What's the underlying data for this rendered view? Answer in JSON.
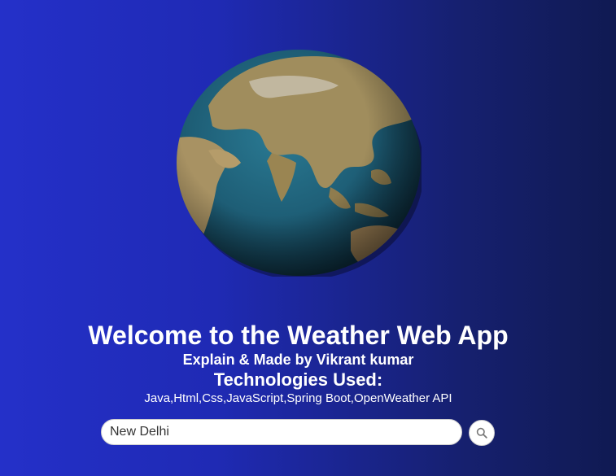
{
  "header": {
    "title": "Welcome to the Weather Web App",
    "subtitle": "Explain & Made by Vikrant kumar",
    "technologies_heading": "Technologies Used:",
    "technologies_list": "Java,Html,Css,JavaScript,Spring Boot,OpenWeather API"
  },
  "search": {
    "value": "New Delhi",
    "button_icon": "search-icon"
  },
  "globe": {
    "icon": "earth-globe-icon"
  },
  "colors": {
    "background_start": "#2430c9",
    "background_end": "#101a52",
    "ocean": "#1e5f78",
    "land": "#9c8a5c",
    "text": "#ffffff"
  }
}
